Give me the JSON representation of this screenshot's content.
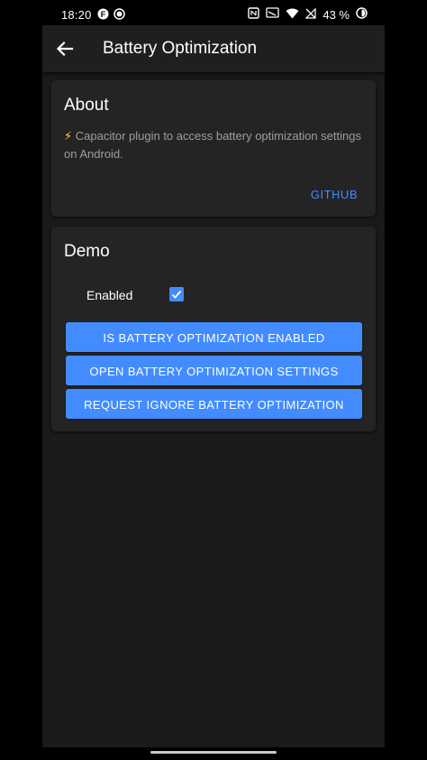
{
  "status_bar": {
    "time": "18:20",
    "battery_percent": "43 %",
    "left_icons": [
      "f-app-icon",
      "record-icon"
    ],
    "right_icons": [
      "nfc-icon",
      "cast-icon",
      "wifi-icon",
      "no-signal-icon",
      "battery-icon"
    ]
  },
  "toolbar": {
    "title": "Battery Optimization",
    "back_icon": "arrow-left-icon"
  },
  "about": {
    "title": "About",
    "bolt": "⚡",
    "description": "Capacitor plugin to access battery optimization settings on Android.",
    "github_label": "GITHUB"
  },
  "demo": {
    "title": "Demo",
    "enabled_label": "Enabled",
    "enabled_checked": true,
    "buttons": [
      {
        "label": "IS BATTERY OPTIMIZATION ENABLED"
      },
      {
        "label": "OPEN BATTERY OPTIMIZATION SETTINGS"
      },
      {
        "label": "REQUEST IGNORE BATTERY OPTIMIZATION"
      }
    ]
  },
  "colors": {
    "accent": "#428cff",
    "background": "#1a1a1a",
    "card": "#242424",
    "toolbar": "#1f1f1f"
  }
}
